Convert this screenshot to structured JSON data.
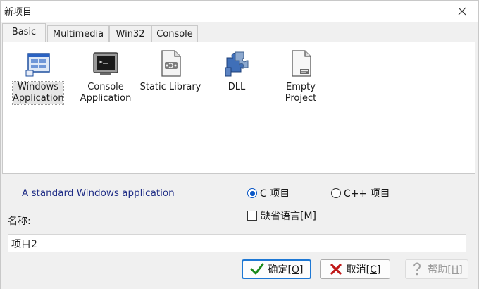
{
  "window": {
    "title": "新项目"
  },
  "tabs": [
    {
      "label": "Basic",
      "active": true
    },
    {
      "label": "Multimedia",
      "active": false
    },
    {
      "label": "Win32",
      "active": false
    },
    {
      "label": "Console",
      "active": false
    }
  ],
  "projects": [
    {
      "line1": "Windows",
      "line2": "Application",
      "icon": "windows-app-icon",
      "selected": true
    },
    {
      "line1": "Console",
      "line2": "Application",
      "icon": "console-app-icon",
      "selected": false
    },
    {
      "line1": "Static Library",
      "line2": "",
      "icon": "static-library-icon",
      "selected": false
    },
    {
      "line1": "DLL",
      "line2": "",
      "icon": "dll-puzzle-icon",
      "selected": false
    },
    {
      "line1": "Empty Project",
      "line2": "",
      "icon": "empty-project-icon",
      "selected": false
    }
  ],
  "description": "A standard Windows application",
  "language": {
    "c_label": "C 项目",
    "cpp_label": "C++ 项目",
    "selected": "C"
  },
  "default_language": {
    "label": "缺省语言[M]",
    "checked": false
  },
  "name": {
    "label": "名称:",
    "value": "项目2"
  },
  "buttons": {
    "ok": {
      "label": "确定",
      "hotkey": "[O]"
    },
    "cancel": {
      "label": "取消",
      "hotkey": "[C]"
    },
    "help": {
      "label": "帮助",
      "hotkey": "[H]"
    }
  },
  "colors": {
    "accent": "#1e78d4",
    "description_text": "#1f2d86",
    "ok_check": "#1a8a1a",
    "cancel_x": "#c01818"
  }
}
